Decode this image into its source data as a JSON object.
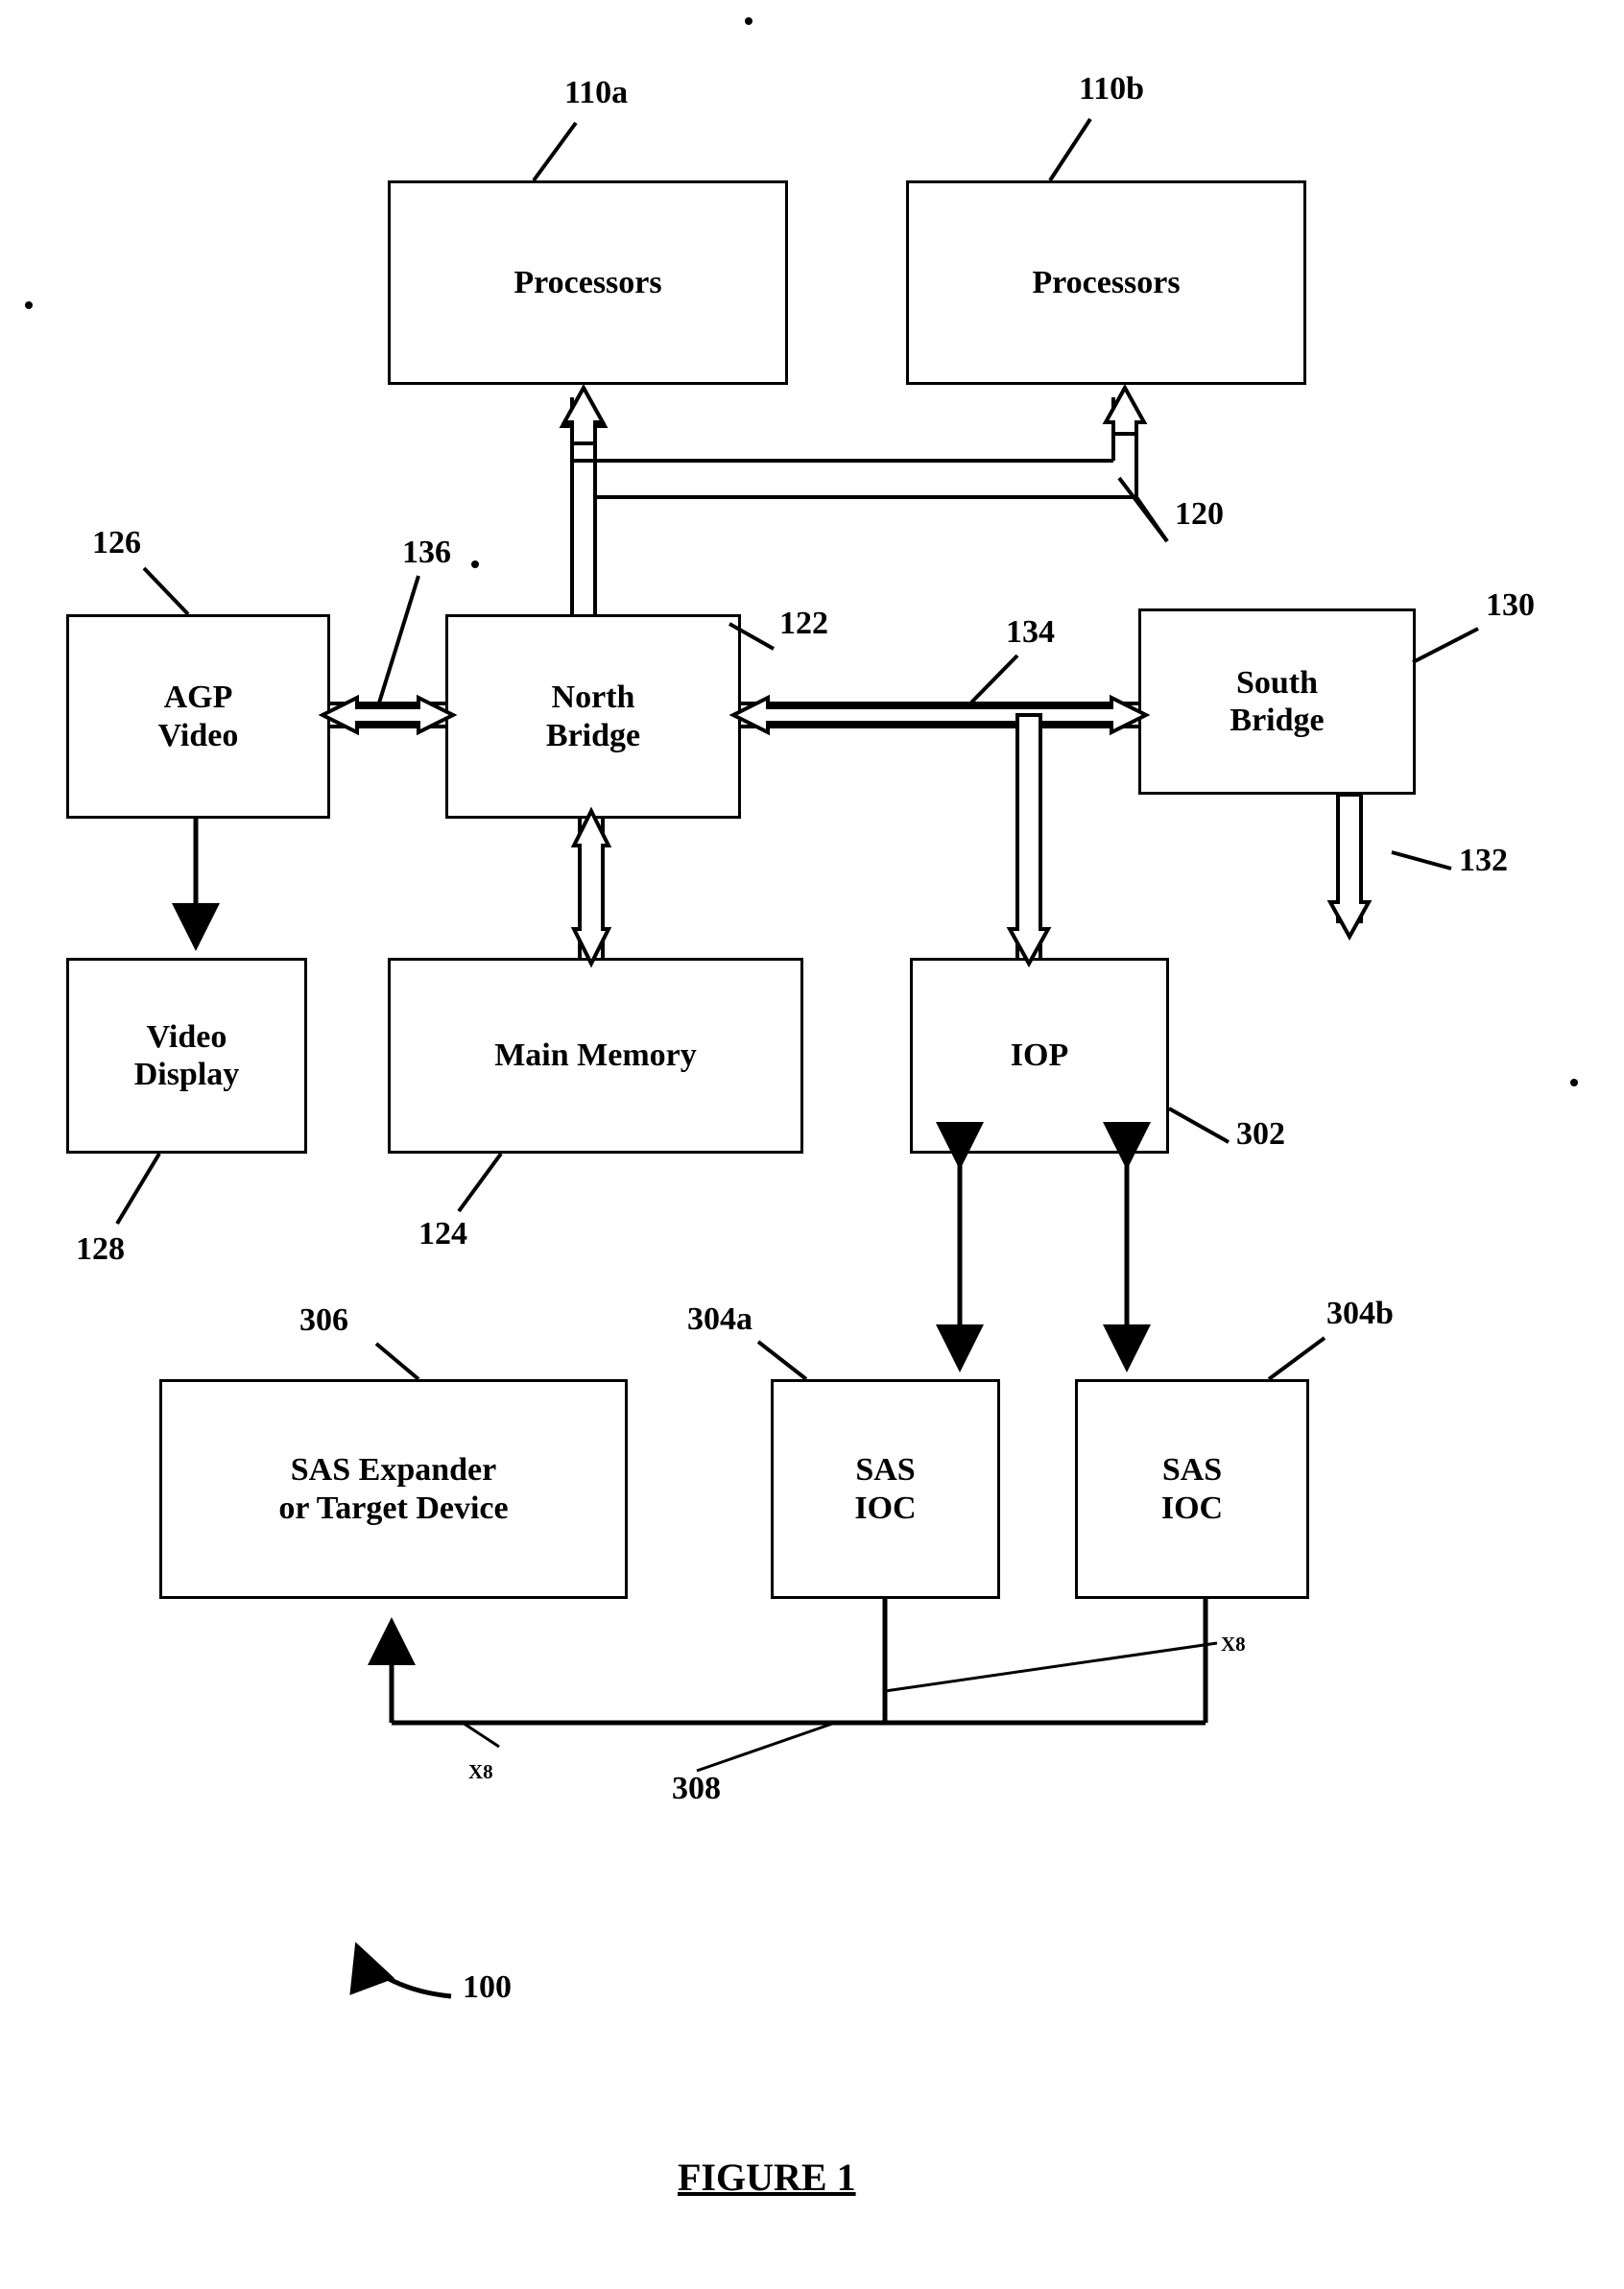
{
  "figure": {
    "title": "FIGURE 1",
    "system_ref": "100"
  },
  "boxes": [
    {
      "id": "processors-a",
      "label": "Processors",
      "ref": "110a"
    },
    {
      "id": "processors-b",
      "label": "Processors",
      "ref": "110b"
    },
    {
      "id": "agp-video",
      "label_line1": "AGP",
      "label_line2": "Video",
      "ref": "126"
    },
    {
      "id": "north-bridge",
      "label_line1": "North",
      "label_line2": "Bridge",
      "ref": "122"
    },
    {
      "id": "south-bridge",
      "label_line1": "South",
      "label_line2": "Bridge",
      "ref": "130"
    },
    {
      "id": "video-display",
      "label_line1": "Video",
      "label_line2": "Display",
      "ref": "128"
    },
    {
      "id": "main-memory",
      "label": "Main Memory",
      "ref": "124"
    },
    {
      "id": "iop",
      "label": "IOP",
      "ref": "302"
    },
    {
      "id": "sas-expander",
      "label_line1": "SAS Expander",
      "label_line2": "or Target Device",
      "ref": "306"
    },
    {
      "id": "sas-ioc-a",
      "label_line1": "SAS",
      "label_line2": "IOC",
      "ref": "304a"
    },
    {
      "id": "sas-ioc-b",
      "label_line1": "SAS",
      "label_line2": "IOC",
      "ref": "304b"
    }
  ],
  "connector_refs": {
    "processor_bus": "120",
    "agp_bus": "136",
    "north_south_bus": "134",
    "south_bridge_bus": "132",
    "sas_link": "308",
    "link_width_left": "X8",
    "link_width_right": "X8"
  }
}
